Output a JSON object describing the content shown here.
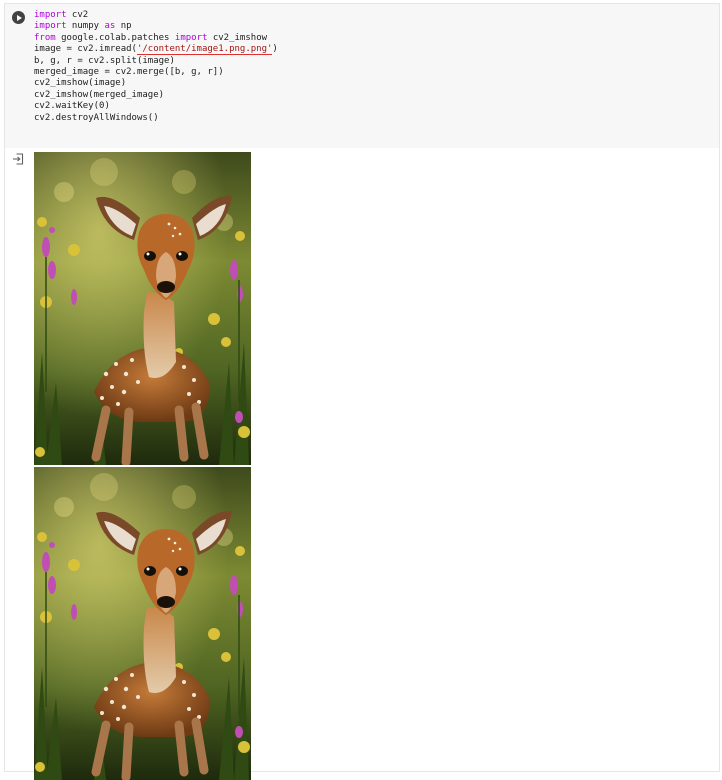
{
  "cell": {
    "code_lines": [
      [
        {
          "t": "import",
          "c": "kw"
        },
        {
          "t": " cv2"
        }
      ],
      [
        {
          "t": "import",
          "c": "kw"
        },
        {
          "t": " numpy "
        },
        {
          "t": "as",
          "c": "kw"
        },
        {
          "t": " np"
        }
      ],
      [
        {
          "t": "from",
          "c": "kw"
        },
        {
          "t": " google.colab.patches "
        },
        {
          "t": "import",
          "c": "kw"
        },
        {
          "t": " cv2_imshow"
        }
      ],
      [
        {
          "t": "image = cv2.imread("
        },
        {
          "t": "'/content/image1.png.png'",
          "c": "str-u"
        },
        {
          "t": ")"
        }
      ],
      [
        {
          "t": "b, g, r = cv2.split(image)"
        }
      ],
      [
        {
          "t": "merged_image = cv2.merge([b, g, r])"
        }
      ],
      [
        {
          "t": "cv2_imshow(image)"
        }
      ],
      [
        {
          "t": "cv2_imshow(merged_image)"
        }
      ],
      [
        {
          "t": "cv2.waitKey(0)"
        }
      ],
      [
        {
          "t": "cv2.destroyAllWindows()"
        }
      ]
    ]
  },
  "output": {
    "images": [
      {
        "label": "image",
        "subject": "fawn-in-wildflower-meadow"
      },
      {
        "label": "merged_image",
        "subject": "fawn-in-wildflower-meadow"
      }
    ]
  },
  "colors": {
    "keyword": "#af00db",
    "string": "#a31515",
    "code_background": "#f7f7f7"
  },
  "icons": {
    "run": "run-cell-icon",
    "output": "output-arrow-icon"
  }
}
